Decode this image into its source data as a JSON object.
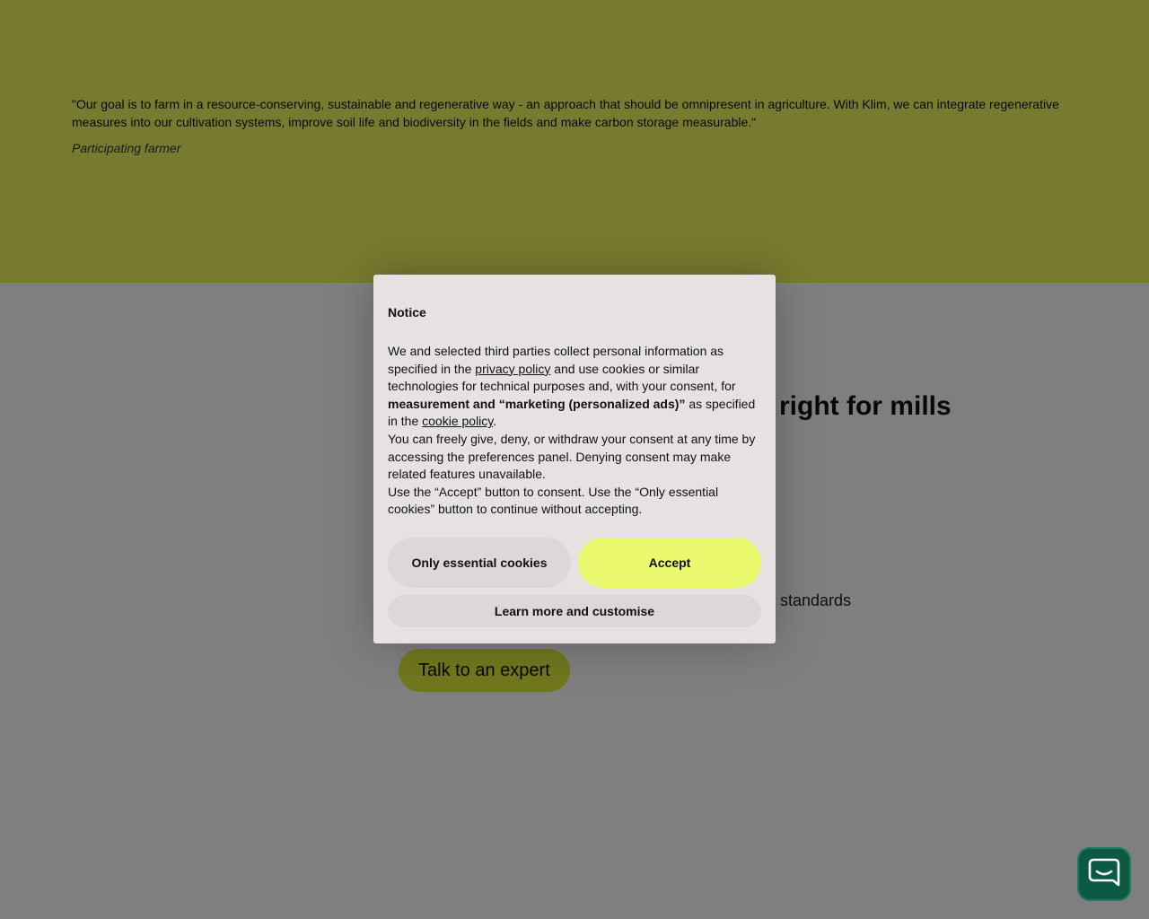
{
  "quote": {
    "text": "\"Our goal is to farm in a resource-conserving, sustainable and regenerative way - an approach that should be omnipresent in agriculture. With Klim, we can integrate regenerative measures into our cultivation systems, improve soil life and biodiversity in the fields and make carbon storage measurable.\"",
    "author": "Participating farmer"
  },
  "content": {
    "heading": "right for mills",
    "feature": "standards",
    "cta_label": "Talk to an expert"
  },
  "cookie_notice": {
    "title": "Notice",
    "p1_a": "We and selected third parties collect personal information as specified in the ",
    "privacy_link": "privacy policy",
    "p1_b": " and use cookies or similar technologies for technical purposes and, with your consent, for ",
    "p1_bold": "measurement and “marketing (personalized ads)”",
    "p1_c": " as specified in the ",
    "cookie_link": "cookie policy",
    "p1_d": ".",
    "p2": "You can freely give, deny, or withdraw your consent at any time by accessing the preferences panel. Denying consent may make related features unavailable.",
    "p3": "Use the “Accept” button to consent. Use the “Only essential cookies” button to continue without accepting.",
    "essential_label": "Only essential cookies",
    "accept_label": "Accept",
    "learn_label": "Learn more and customise"
  },
  "colors": {
    "quote_bg": "#eff760",
    "accept_bg": "#eaf96d",
    "chat_bg": "#0d5a44"
  },
  "icons": {
    "chat": "chat-bubble-icon"
  }
}
